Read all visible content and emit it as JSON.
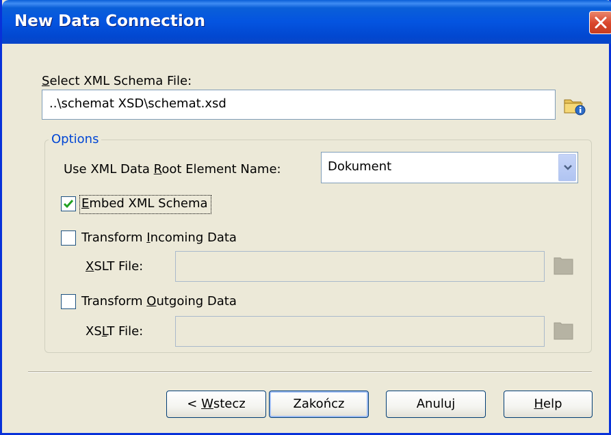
{
  "window": {
    "title": "New Data Connection"
  },
  "schema": {
    "label_prefix": "",
    "label_accel": "S",
    "label_rest": "elect XML Schema File:",
    "value": "..\\schemat XSD\\schemat.xsd",
    "browse_icon": "folder-browse-icon"
  },
  "options": {
    "group_title": "Options",
    "root_label_prefix": "Use XML Data ",
    "root_label_accel": "R",
    "root_label_rest": "oot Element Name:",
    "root_value": "Dokument",
    "embed": {
      "accel": "E",
      "rest": "mbed XML Schema",
      "checked": true
    },
    "incoming": {
      "prefix": "Transform ",
      "accel": "I",
      "rest": "ncoming Data",
      "checked": false
    },
    "incoming_xslt": {
      "accel": "X",
      "rest": "SLT File:",
      "value": ""
    },
    "outgoing": {
      "prefix": "Transform ",
      "accel": "O",
      "rest": "utgoing Data",
      "checked": false
    },
    "outgoing_xslt": {
      "prefix": "XS",
      "accel": "L",
      "rest": "T File:",
      "value": ""
    }
  },
  "buttons": {
    "back": {
      "prefix": "< ",
      "accel": "W",
      "rest": "stecz"
    },
    "finish": {
      "label": "Zakończ"
    },
    "cancel": {
      "label": "Anuluj"
    },
    "help": {
      "accel": "H",
      "rest": "elp"
    }
  },
  "colors": {
    "titlebar": "#0454e0",
    "dialog_bg": "#ece9d8",
    "group_title": "#0046d5",
    "close": "#d9442a"
  }
}
